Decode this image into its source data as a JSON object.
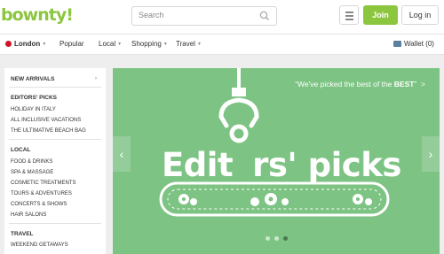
{
  "header": {
    "logo": "bownty!",
    "search_placeholder": "Search",
    "join_label": "Join",
    "login_label": "Log in"
  },
  "nav": {
    "city": "London",
    "items": [
      {
        "label": "Popular",
        "has_dropdown": false
      },
      {
        "label": "Local",
        "has_dropdown": true
      },
      {
        "label": "Shopping",
        "has_dropdown": true
      },
      {
        "label": "Travel",
        "has_dropdown": true
      }
    ],
    "wallet": "Wallet (0)"
  },
  "sidebar": {
    "new_arrivals": "NEW ARRIVALS",
    "editors_picks": {
      "heading": "EDITORS' PICKS",
      "items": [
        "HOLIDAY IN ITALY",
        "ALL INCLUSIVE VACATIONS",
        "THE ULTIMATIVE BEACH BAG"
      ]
    },
    "local": {
      "heading": "LOCAL",
      "items": [
        "FOOD & DRINKS",
        "SPA & MASSAGE",
        "COSMETIC TREATMENTS",
        "TOURS & ADVENTURES",
        "CONCERTS & SHOWS",
        "HAIR SALONS"
      ]
    },
    "travel": {
      "heading": "TRAVEL",
      "items": [
        "WEEKEND GETAWAYS"
      ]
    }
  },
  "hero": {
    "tagline_prefix": "“We've picked the best of the ",
    "tagline_bold": "BEST",
    "tagline_suffix": "”",
    "tagline_arrow": ">",
    "title_part1": "Edit",
    "title_part2": "rs' picks",
    "slide_count": 3,
    "active_slide": 3
  },
  "colors": {
    "brand_green": "#8cc63f",
    "hero_green": "#7dc383",
    "flag_red": "#cf142b"
  },
  "icons": [
    "search-icon",
    "hamburger-icon",
    "uk-flag-icon",
    "wallet-icon",
    "claw-icon",
    "gear-icon",
    "chevron-left-icon",
    "chevron-right-icon"
  ]
}
